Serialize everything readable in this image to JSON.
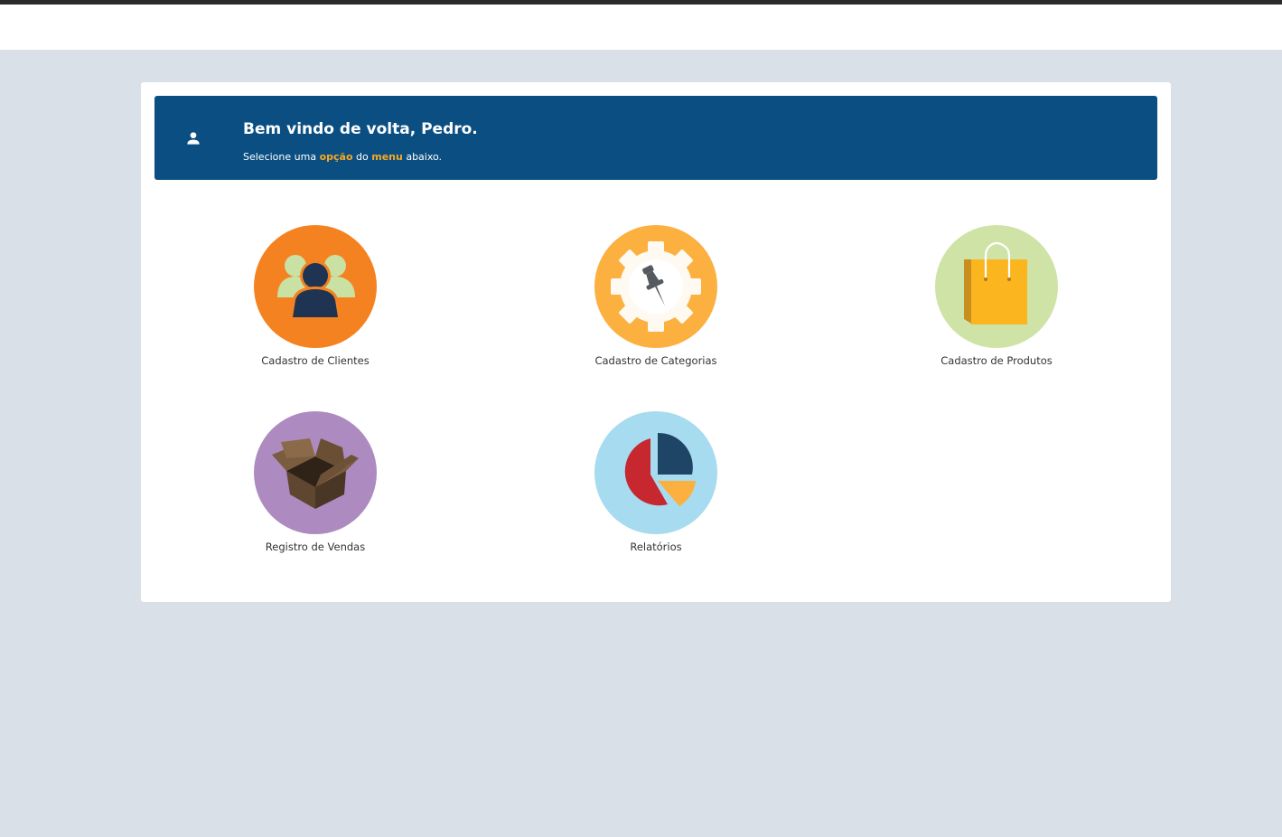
{
  "banner": {
    "title": "Bem vindo de volta, Pedro.",
    "subtitle_prefix": "Selecione uma ",
    "highlight_1": "opção",
    "subtitle_mid": " do ",
    "highlight_2": "menu",
    "subtitle_suffix": " abaixo.",
    "icon": "user-icon"
  },
  "menu": {
    "items": [
      {
        "label": "Cadastro de Clientes",
        "icon": "customers-icon",
        "color": "#f58220"
      },
      {
        "label": "Cadastro de Categorias",
        "icon": "settings-gear-icon",
        "color": "#fbb040"
      },
      {
        "label": "Cadastro de Produtos",
        "icon": "shopping-bag-icon",
        "color": "#cfe3a6"
      },
      {
        "label": "Registro de Vendas",
        "icon": "open-box-icon",
        "color": "#ad8ac0"
      },
      {
        "label": "Relatórios",
        "icon": "pie-chart-icon",
        "color": "#a7dbef"
      }
    ]
  },
  "colors": {
    "page_background": "#dae0e8",
    "banner_background": "#0b4f82",
    "highlight": "#f7a823"
  }
}
